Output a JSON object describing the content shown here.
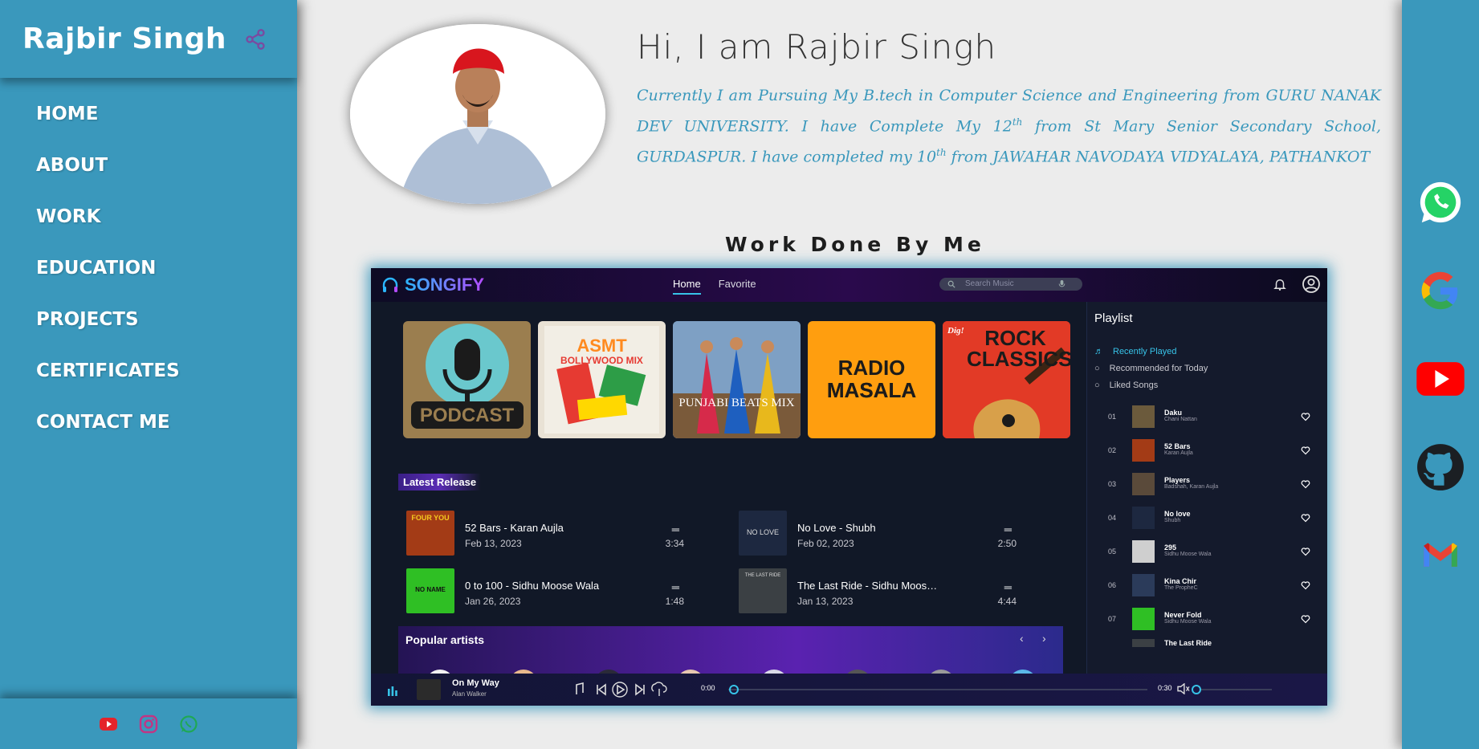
{
  "sidebar": {
    "brand": "Rajbir Singh",
    "nav": [
      "HOME",
      "ABOUT",
      "WORK",
      "EDUCATION",
      "PROJECTS",
      "CERTIFICATES",
      "CONTACT ME"
    ],
    "footer_icons": [
      "youtube-icon",
      "instagram-icon",
      "whatsapp-icon"
    ]
  },
  "profile": {
    "greeting": "Hi, I am Rajbir Singh",
    "bio_1": "Currently I am Pursuing My B.tech in Computer Science and Engineering from GURU NANAK DEV UNIVERSITY. I have Complete My 12",
    "sup_1": "th",
    "bio_2": " from St Mary Senior Secondary School, GURDASPUR. I have completed my 10",
    "sup_2": "th",
    "bio_3": " from JAWAHAR NAVODAYA VIDYALAYA, PATHANKOT"
  },
  "work": {
    "title": "Work Done By Me"
  },
  "songify": {
    "logo": "SONGIFY",
    "tabs": [
      "Home",
      "Favorite"
    ],
    "search_placeholder": "Search Music",
    "covers": [
      {
        "label": "PODCAST",
        "bg": "#9b7e4f"
      },
      {
        "label": "BOLLYWOOD MIX",
        "bg": "#e9e2d5"
      },
      {
        "label": "PUNJABI BEATS MIX",
        "bg": "#6a86a8"
      },
      {
        "label": "RADIO MASALA",
        "bg": "#ff9e0f"
      },
      {
        "label": "ROCK CLASSICS",
        "bg": "#e23a26"
      }
    ],
    "cover_extra": {
      "asmt": "ASMT",
      "dig": "Dig!"
    },
    "latest_release_label": "Latest Release",
    "latest": [
      {
        "title": "52 Bars - Karan Aujla",
        "date": "Feb 13, 2023",
        "duration": "3:34",
        "thumb_text": "FOUR YOU",
        "bg": "#a33b16"
      },
      {
        "title": "No Love - Shubh",
        "date": "Feb 02, 2023",
        "duration": "2:50",
        "thumb_text": "NO LOVE",
        "bg": "#1d2840"
      },
      {
        "title": "0 to 100 - Sidhu Moose Wala",
        "date": "Jan 26, 2023",
        "duration": "1:48",
        "thumb_text": "NO NAME",
        "bg": "#2fbf24"
      },
      {
        "title": "The Last Ride - Sidhu Moos…",
        "date": "Jan 13, 2023",
        "duration": "4:44",
        "thumb_text": "THE LAST RIDE",
        "bg": "#3b4044"
      }
    ],
    "eq_symbol": "═",
    "popular_label": "Popular artists",
    "arrows": [
      "‹",
      "›"
    ],
    "playlist": {
      "title": "Playlist",
      "menu": [
        "Recently Played",
        "Recommended for Today",
        "Liked Songs"
      ],
      "tracks": [
        {
          "no": "01",
          "name": "Daku",
          "artist": "Chani Nattan",
          "bg": "#6b5a3c"
        },
        {
          "no": "02",
          "name": "52 Bars",
          "artist": "Karan Aujla",
          "bg": "#a33b16"
        },
        {
          "no": "03",
          "name": "Players",
          "artist": "Badshah, Karan Aujla",
          "bg": "#5a4a3a"
        },
        {
          "no": "04",
          "name": "No love",
          "artist": "Shubh",
          "bg": "#1d2840"
        },
        {
          "no": "05",
          "name": "295",
          "artist": "Sidhu Moose Wala",
          "bg": "#cfcfcf"
        },
        {
          "no": "06",
          "name": "Kina Chir",
          "artist": "The PropheC",
          "bg": "#2b3b5a"
        },
        {
          "no": "07",
          "name": "Never Fold",
          "artist": "Sidhu Moose Wala",
          "bg": "#2fbf24"
        },
        {
          "no": "",
          "name": "The Last Ride",
          "artist": "",
          "bg": "#3b4044"
        }
      ]
    },
    "player": {
      "track": "On My Way",
      "artist": "Alan Walker",
      "time_now": "0:00",
      "time_total": "0:30",
      "progress": 0
    }
  },
  "rail": {
    "icons": [
      "whatsapp-icon",
      "google-icon",
      "youtube-icon",
      "github-icon",
      "gmail-icon"
    ]
  },
  "colors": {
    "sidebar": "#3a98bc",
    "accent": "#37c3e8",
    "bio": "#3a98bc"
  }
}
